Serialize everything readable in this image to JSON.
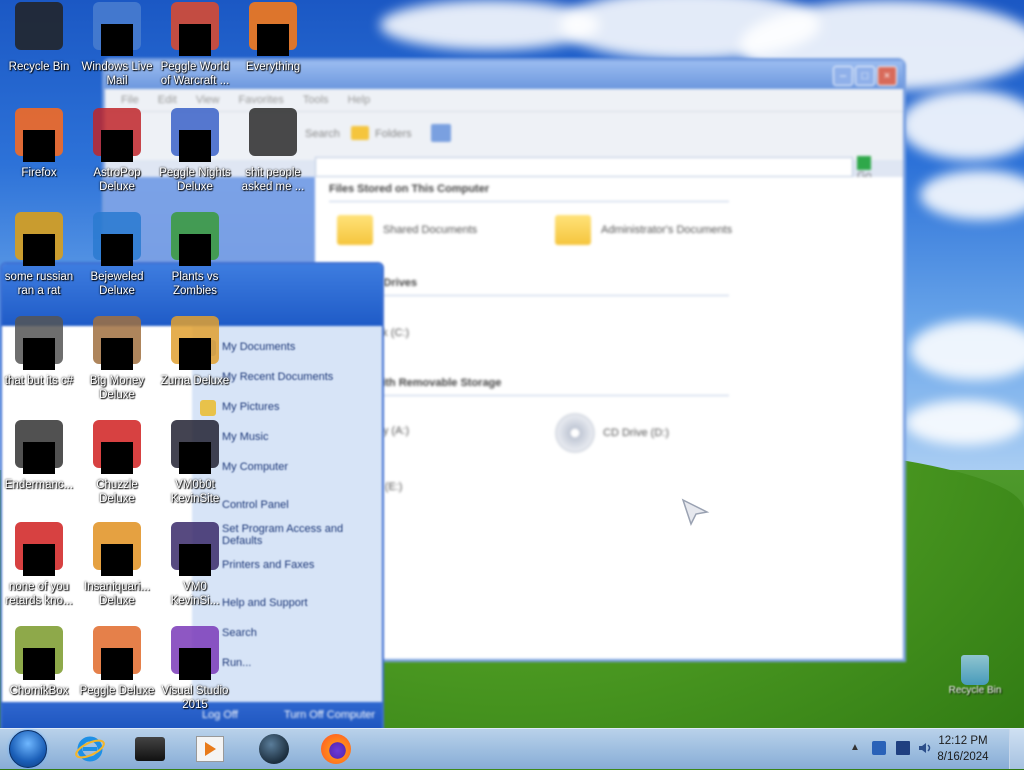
{
  "desktop": {
    "icons": [
      {
        "label": "Recycle Bin",
        "icon": "recycle-bin-icon",
        "masked": false
      },
      {
        "label": "Windows Live\nMail",
        "icon": "windows-live-mail-icon",
        "masked": true
      },
      {
        "label": "Peggle World\nof Warcraft ...",
        "icon": "peggle-icon",
        "masked": true
      },
      {
        "label": "Everything",
        "icon": "everything-search-icon",
        "masked": true
      },
      {
        "label": "Firefox",
        "icon": "firefox-icon",
        "masked": true
      },
      {
        "label": "AstroPop\nDeluxe",
        "icon": "astropop-icon",
        "masked": true
      },
      {
        "label": "Peggle Nights\nDeluxe",
        "icon": "peggle-nights-icon",
        "masked": true
      },
      {
        "label": "shit people\nasked me ...",
        "icon": "folder-icon",
        "masked": false
      },
      {
        "label": "some russian\nran a rat",
        "icon": "app-icon",
        "masked": true
      },
      {
        "label": "Bejeweled\nDeluxe",
        "icon": "bejeweled-icon",
        "masked": true
      },
      {
        "label": "Plants vs\nZombies",
        "icon": "plants-vs-zombies-icon",
        "masked": true
      },
      {
        "label": "that but its c#",
        "icon": "app-icon",
        "masked": true
      },
      {
        "label": "Big Money\nDeluxe",
        "icon": "big-money-icon",
        "masked": true
      },
      {
        "label": "Zuma Deluxe",
        "icon": "zuma-icon",
        "masked": true
      },
      {
        "label": "Endermanc...",
        "icon": "app-icon",
        "masked": true
      },
      {
        "label": "Chuzzle\nDeluxe",
        "icon": "chuzzle-icon",
        "masked": true
      },
      {
        "label": "VM0b0t\nKevinSite",
        "icon": "vm-icon",
        "masked": true
      },
      {
        "label": "none of you\nretards kno...",
        "icon": "app-icon",
        "masked": true
      },
      {
        "label": "Insaniquari...\nDeluxe",
        "icon": "insaniquarium-icon",
        "masked": true
      },
      {
        "label": "VM0\nKevinSi...",
        "icon": "vm-icon",
        "masked": true
      },
      {
        "label": "ChomikBox",
        "icon": "chomikbox-icon",
        "masked": true
      },
      {
        "label": "Peggle Deluxe",
        "icon": "peggle-deluxe-icon",
        "masked": true
      },
      {
        "label": "Visual Studio\n2015",
        "icon": "visual-studio-icon",
        "masked": true
      }
    ],
    "recycle_bin_right": {
      "label": "Recycle Bin"
    }
  },
  "explorer": {
    "menu": [
      "File",
      "Edit",
      "View",
      "Favorites",
      "Tools",
      "Help"
    ],
    "toolbar": {
      "search": "Search",
      "folders": "Folders"
    },
    "go_label": "Go",
    "sections": {
      "stored": "Files Stored on This Computer",
      "drives": "Hard Disk Drives",
      "removable": "Devices with Removable Storage"
    },
    "items": {
      "shared_docs": "Shared Documents",
      "admin_docs": "Administrator's Documents",
      "local_disk": "Local Disk (C:)",
      "floppy": "3½ Floppy (A:)",
      "cd_drive": "CD Drive (D:)",
      "cd_drive_e": "CD Drive (E:)"
    }
  },
  "start_menu": {
    "items": [
      "My Documents",
      "My Recent Documents",
      "My Pictures",
      "My Music",
      "My Computer",
      "Control Panel",
      "Set Program Access and Defaults",
      "Printers and Faxes",
      "Help and Support",
      "Search",
      "Run..."
    ],
    "logoff": "Log Off",
    "turnoff": "Turn Off Computer"
  },
  "taskbar": {
    "pinned": [
      "internet-explorer-icon",
      "black-app-icon",
      "media-player-icon",
      "globe-app-icon",
      "firefox-icon"
    ],
    "clock_time": "12:12 PM",
    "clock_date": "8/16/2024"
  }
}
